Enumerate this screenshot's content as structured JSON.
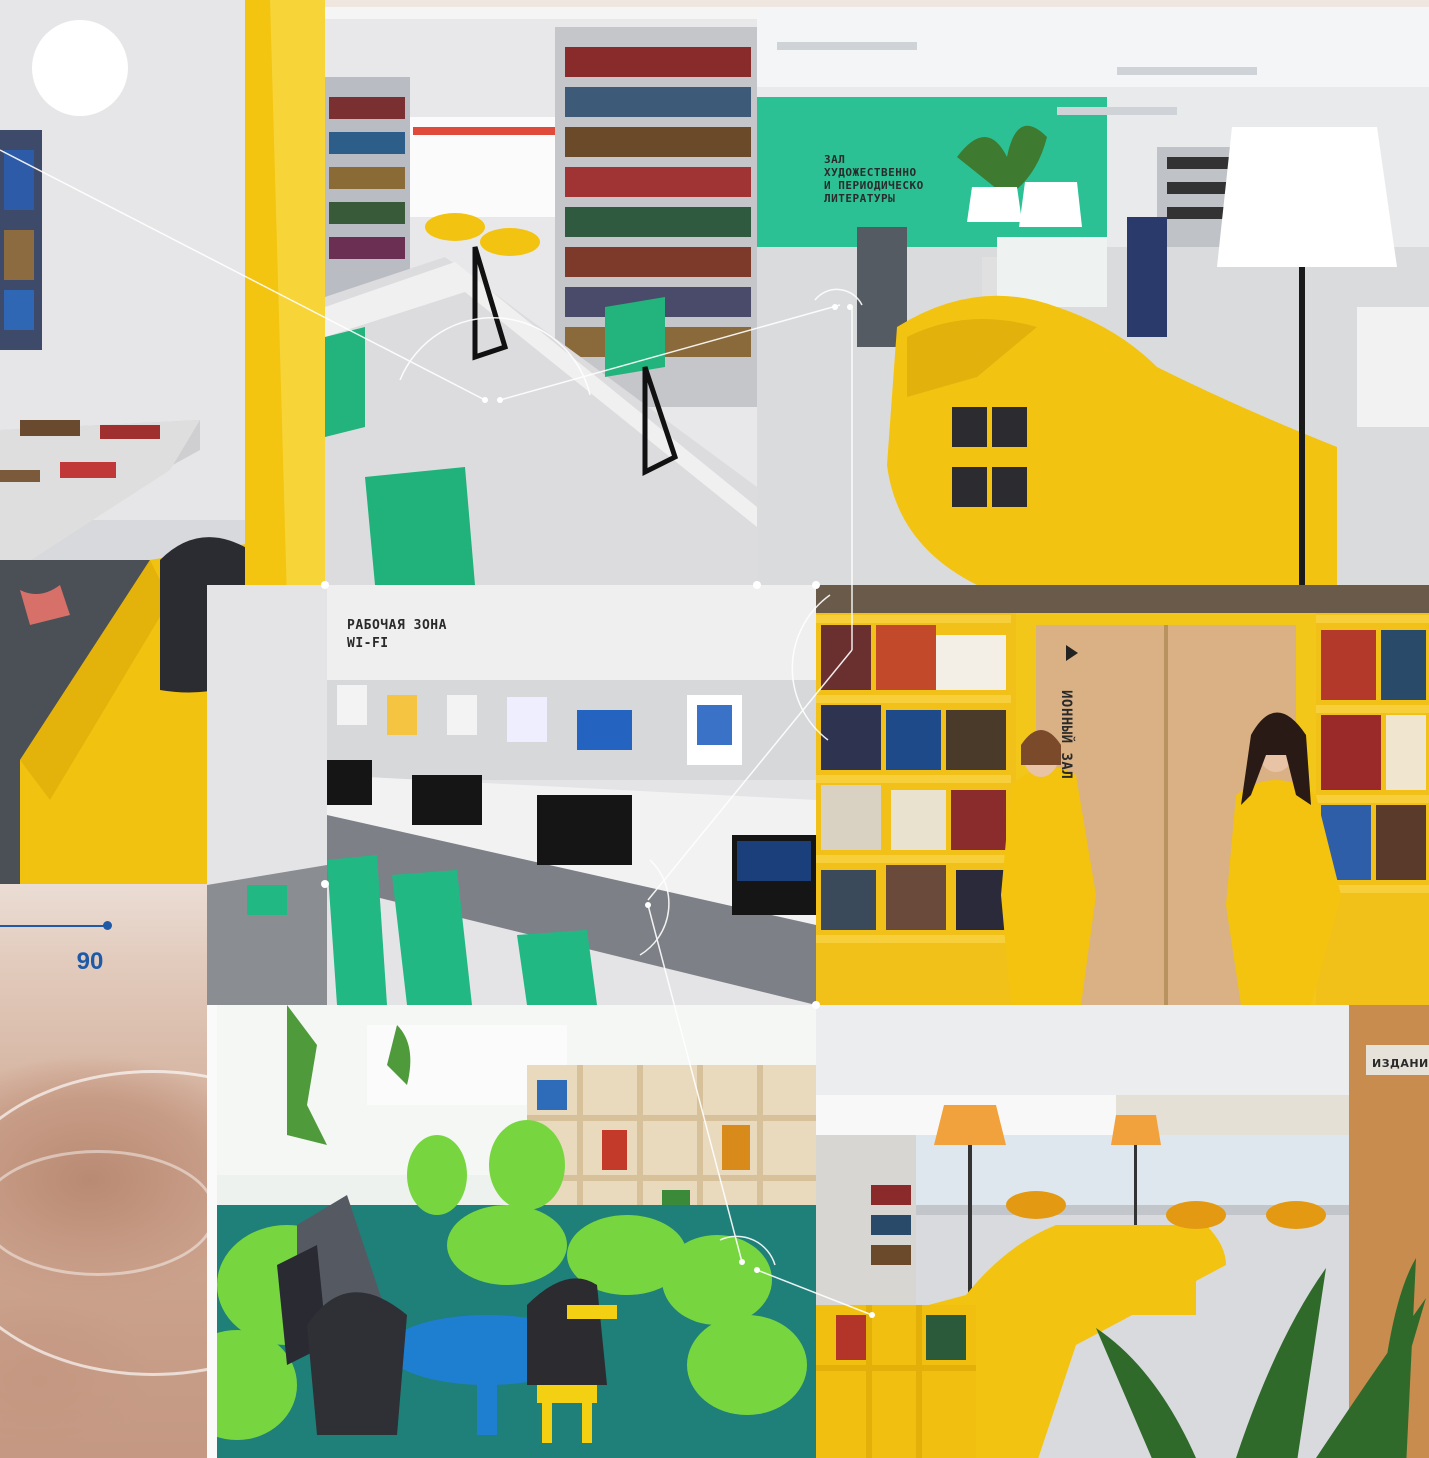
{
  "page": {
    "number": "90"
  },
  "signs": {
    "work_zone_line1": "РАБОЧАЯ ЗОНА",
    "work_zone_line2": "WI-FI",
    "hall_line1": "ЗАЛ",
    "hall_line2": "ХУДОЖЕСТВЕННО",
    "hall_line3": "И ПЕРИОДИЧЕСКО",
    "hall_line4": "ЛИТЕРАТУРЫ",
    "door_sign": "ИОННЫЙ ЗАЛ",
    "periodicals_label": "ИЗДАНИЯ"
  },
  "colors": {
    "accent_yellow": "#f4c20d",
    "accent_green": "#2fbf8a",
    "lime": "#7fd94a",
    "page_number_blue": "#1f5aa6"
  }
}
